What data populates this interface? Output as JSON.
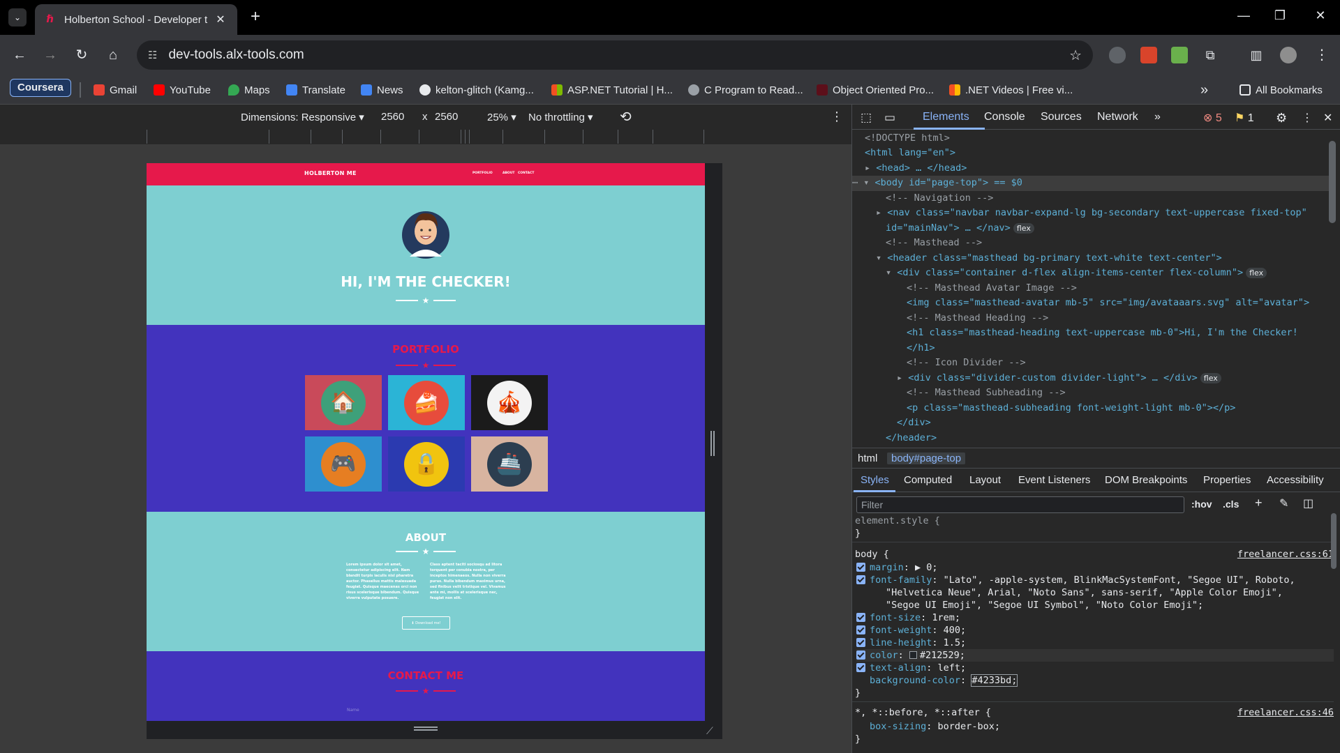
{
  "browser": {
    "tab_title": "Holberton School - Developer t",
    "url": "dev-tools.alx-tools.com",
    "tab_close": "✕",
    "new_tab": "+",
    "window_controls": [
      "—",
      "❐",
      "✕"
    ]
  },
  "bookmarks": {
    "items": [
      {
        "label": "Coursera",
        "icon": "coursera-icon"
      },
      {
        "label": "Gmail",
        "icon": "gmail-icon",
        "color": "#ea4335"
      },
      {
        "label": "YouTube",
        "icon": "youtube-icon",
        "color": "#ff0000"
      },
      {
        "label": "Maps",
        "icon": "maps-icon",
        "color": "#34a853"
      },
      {
        "label": "Translate",
        "icon": "translate-icon",
        "color": "#4285f4"
      },
      {
        "label": "News",
        "icon": "news-icon",
        "color": "#4285f4"
      },
      {
        "label": "kelton-glitch (Kamg...",
        "icon": "github-icon",
        "color": "#e8eaed"
      },
      {
        "label": "ASP.NET Tutorial | H...",
        "icon": "microsoft-icon",
        "color": "#f25022"
      },
      {
        "label": "C Program to Read...",
        "icon": "globe-icon",
        "color": "#e8eaed"
      },
      {
        "label": "Object Oriented Pro...",
        "icon": "site-icon",
        "color": "#5c0f1a"
      },
      {
        "label": ".NET Videos | Free vi...",
        "icon": "microsoft-icon",
        "color": "#f25022"
      }
    ],
    "more": "»",
    "all_bookmarks": "All Bookmarks"
  },
  "device_toolbar": {
    "dimensions": "Dimensions: Responsive ▾",
    "width": "2560",
    "times": "x",
    "height": "2560",
    "zoom": "25% ▾",
    "throttling": "No throttling ▾",
    "rotate": "⟲",
    "menu": "⋮"
  },
  "page_preview": {
    "brand": "HOLBERTON ME",
    "nav_links": [
      "PORTFOLIO",
      "ABOUT",
      "CONTACT"
    ],
    "hero_heading": "HI, I'M THE CHECKER!",
    "portfolio_title": "PORTFOLIO",
    "about_title": "ABOUT",
    "about_left": "Lorem ipsum dolor sit amet, consectetur adipiscing elit. Nam blandit turpis iaculis nisl pharetra auctor. Phasellus mattis malesuada feugiat. Quisque maecenas orci non risus scelerisque bibendum. Quisque viverra vulputate posuere.",
    "about_right": "Class aptent taciti sociosqu ad litora torquent per conubia nostra, per inceptos himenaeos. Nulla non viverra purus. Nulla bibendum maximus urna, sed finibus velit tristique vel. Vivamus ante mi, mollis at scelerisque nec, feugiat non elit.",
    "download_btn": "⬇ Download me!",
    "contact_title": "CONTACT ME",
    "name_placeholder": "Name",
    "colors": {
      "primary": "#7ecfd1",
      "secondary": "#4233bd",
      "accent": "#e6194b"
    }
  },
  "devtools": {
    "tabs": [
      "Elements",
      "Console",
      "Sources",
      "Network",
      "»"
    ],
    "errors": "5",
    "warnings": "1",
    "dom_lines": [
      "<!DOCTYPE html>",
      "<html lang=\"en\">",
      "<head> … </head>",
      "<body id=\"page-top\"> == $0",
      "<!-- Navigation -->",
      "<nav class=\"navbar navbar-expand-lg bg-secondary text-uppercase fixed-top\"",
      "id=\"mainNav\"> … </nav>",
      "<!-- Masthead -->",
      "<header class=\"masthead bg-primary text-white text-center\">",
      "<div class=\"container d-flex align-items-center flex-column\">",
      "<!-- Masthead Avatar Image -->",
      "<img class=\"masthead-avatar mb-5\" src=\"img/avataaars.svg\" alt=\"avatar\">",
      "<!-- Masthead Heading -->",
      "<h1 class=\"masthead-heading text-uppercase mb-0\">Hi, I'm the Checker!",
      "</h1>",
      "<!-- Icon Divider -->",
      "<div class=\"divider-custom divider-light\"> … </div>",
      "<!-- Masthead Subheading -->",
      "<p class=\"masthead-subheading font-weight-light mb-0\"></p>",
      "</div>",
      "</header>"
    ],
    "chip_flex": "flex",
    "breadcrumbs": [
      "html",
      "body#page-top"
    ],
    "subtabs": [
      "Styles",
      "Computed",
      "Layout",
      "Event Listeners",
      "DOM Breakpoints",
      "Properties",
      "Accessibility"
    ],
    "filter_placeholder": "Filter",
    "hov": ":hov",
    "cls": ".cls",
    "styles": {
      "element_style": "element.style {",
      "close_brace": "}",
      "body_selector": "body {",
      "body_source": "freelancer.css:61",
      "props": [
        {
          "name": "margin",
          "value": "▶ 0;"
        },
        {
          "name": "font-family",
          "value": "\"Lato\", -apple-system, BlinkMacSystemFont, \"Segoe UI\", Roboto,"
        },
        {
          "name": "font-size",
          "value": "1rem;"
        },
        {
          "name": "font-weight",
          "value": "400;"
        },
        {
          "name": "line-height",
          "value": "1.5;"
        },
        {
          "name": "color",
          "value": "#212529;"
        },
        {
          "name": "text-align",
          "value": "left;"
        },
        {
          "name": "background-color",
          "value": "#4233bd;"
        }
      ],
      "font_family_cont1": "\"Helvetica Neue\", Arial, \"Noto Sans\", sans-serif, \"Apple Color Emoji\",",
      "font_family_cont2": "\"Segoe UI Emoji\", \"Segoe UI Symbol\", \"Noto Color Emoji\";",
      "universal_selector": "*, *::before, *::after {",
      "universal_source": "freelancer.css:46",
      "universal_prop": "box-sizing",
      "universal_val": "border-box;"
    }
  }
}
